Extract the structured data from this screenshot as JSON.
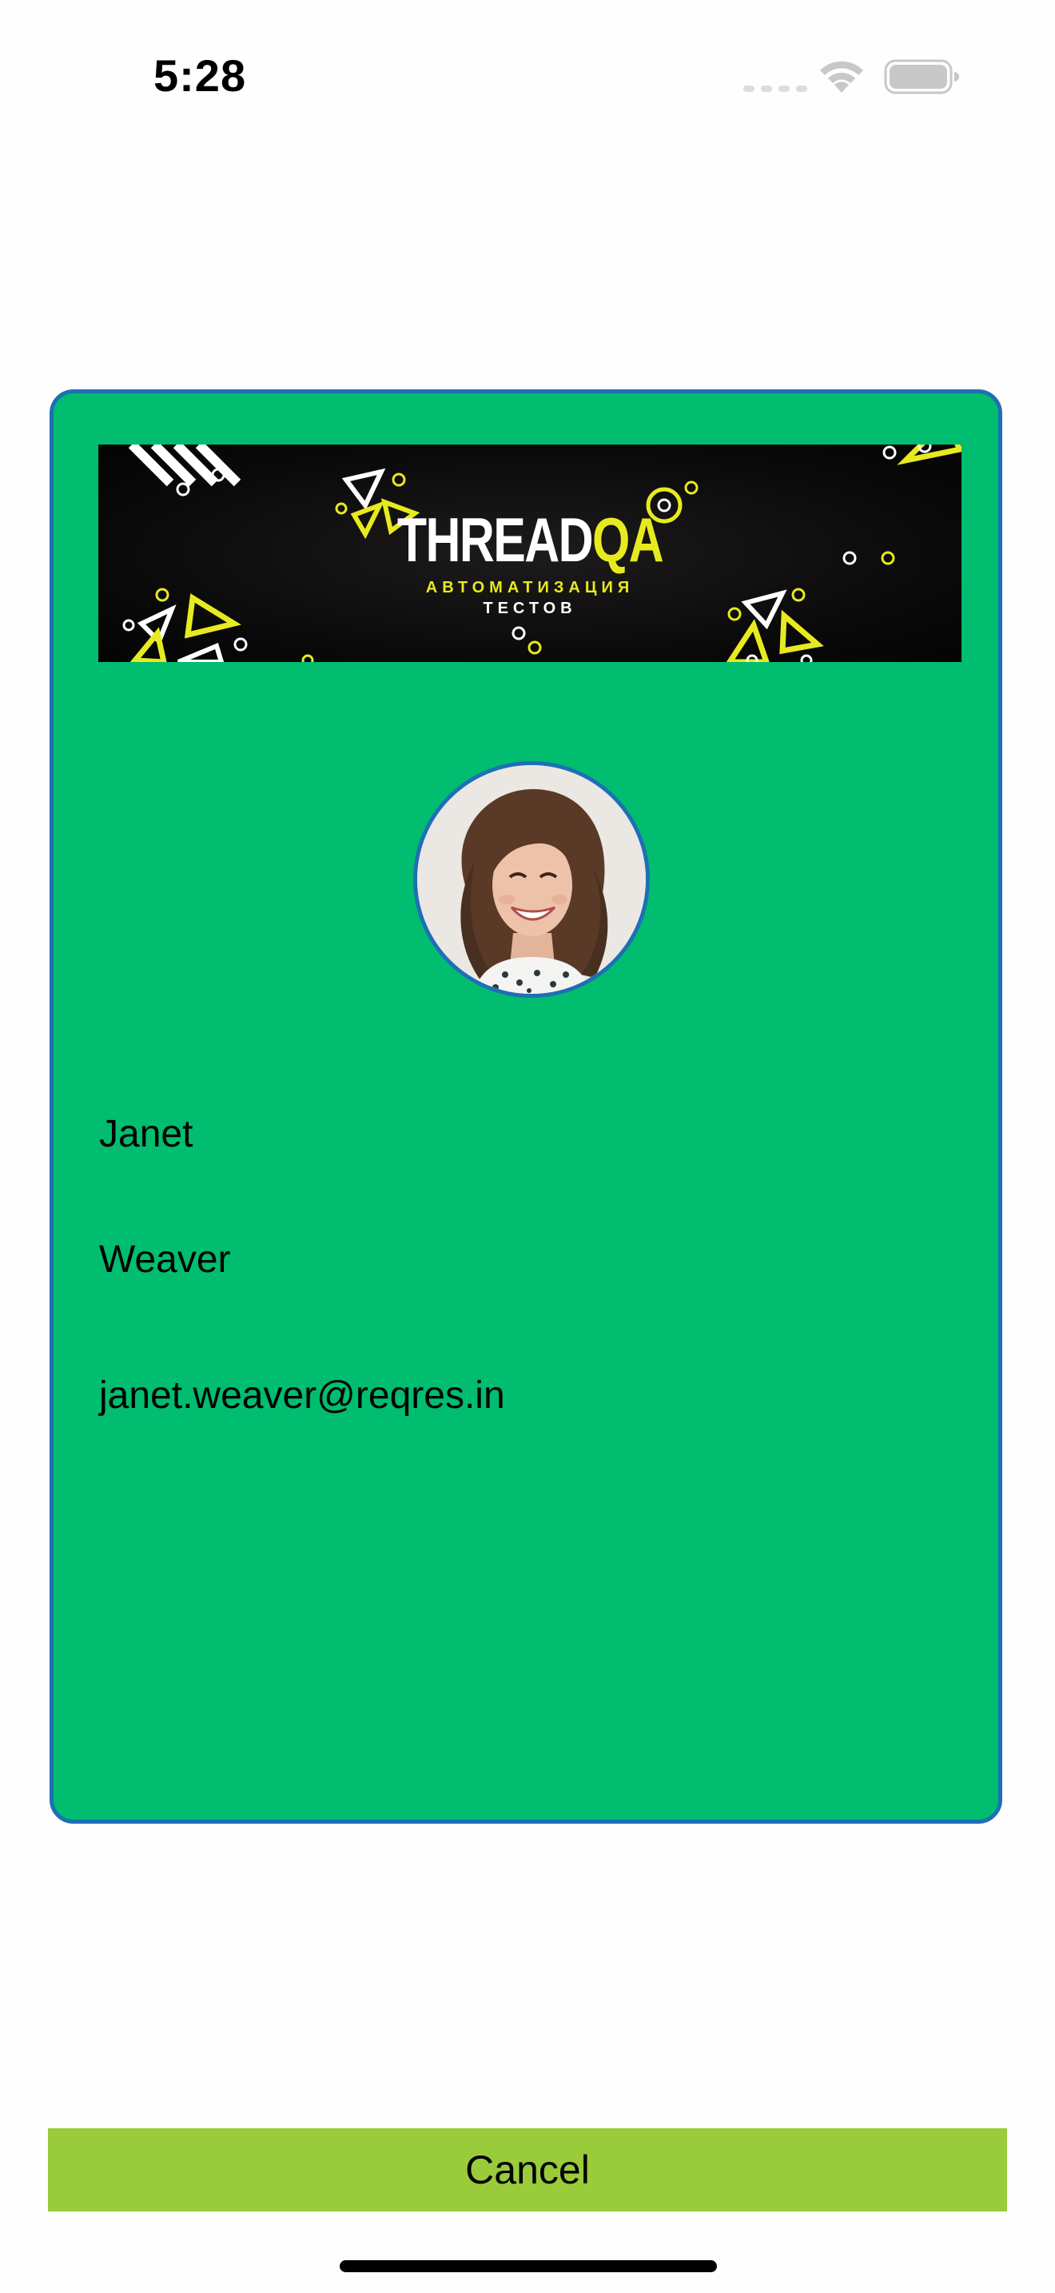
{
  "status_bar": {
    "time": "5:28",
    "icons": [
      "cellular-signal-icon",
      "wifi-icon",
      "battery-icon"
    ]
  },
  "card": {
    "background_color": "#00bd6f",
    "border_color": "#1e6fb5",
    "banner": {
      "title_part1": "THREAD",
      "title_part2": "QA",
      "subtitle_line1": "АВТОМАТИЗАЦИЯ",
      "subtitle_line2": "ТЕСТОВ",
      "accent_color": "#e7ea1f"
    },
    "avatar": "user-avatar-photo",
    "first_name": "Janet",
    "last_name": "Weaver",
    "email": "janet.weaver@reqres.in"
  },
  "actions": {
    "cancel_label": "Cancel",
    "cancel_color": "#99cb3a"
  }
}
